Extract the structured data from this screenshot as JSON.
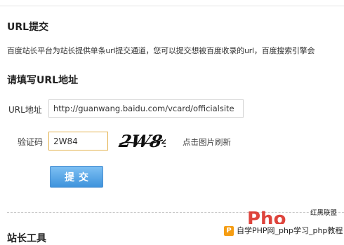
{
  "section1": {
    "title": "URL提交"
  },
  "intro": "百度站长平台为站长提供单条url提交通道，您可以提交想被百度收录的url，百度搜索引擎会",
  "section2": {
    "title": "请填写URL地址"
  },
  "form": {
    "url_label": "URL地址",
    "url_value": "http://guanwang.baidu.com/vcard/officialsite",
    "code_label": "验证码",
    "code_value": "2W84",
    "captcha_text": "2W84",
    "refresh_label": "点击图片刷新",
    "submit_label": "提交"
  },
  "section3": {
    "title": "站长工具"
  },
  "watermark": {
    "logo_text": "Pho",
    "side_line1": "红黑联盟",
    "side_line2": "",
    "bar_text": "自学PHP网_php学习_php教程"
  },
  "colors": {
    "accent_button": "#3e93dc",
    "focus_border": "#e3b24f",
    "watermark_red": "#d9241b"
  }
}
